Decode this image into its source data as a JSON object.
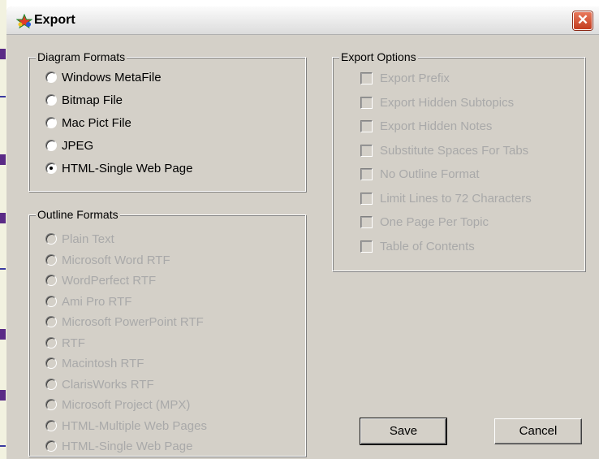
{
  "window": {
    "title": "Export",
    "close_label": "✕"
  },
  "diagram_formats": {
    "title": "Diagram Formats",
    "options": [
      {
        "label": "Windows MetaFile",
        "selected": false,
        "enabled": true
      },
      {
        "label": "Bitmap File",
        "selected": false,
        "enabled": true
      },
      {
        "label": "Mac Pict File",
        "selected": false,
        "enabled": true
      },
      {
        "label": "JPEG",
        "selected": false,
        "enabled": true
      },
      {
        "label": "HTML-Single Web Page",
        "selected": true,
        "enabled": true
      }
    ]
  },
  "outline_formats": {
    "title": "Outline Formats",
    "options": [
      {
        "label": "Plain Text",
        "enabled": false
      },
      {
        "label": "Microsoft Word RTF",
        "enabled": false
      },
      {
        "label": "WordPerfect RTF",
        "enabled": false
      },
      {
        "label": "Ami Pro RTF",
        "enabled": false
      },
      {
        "label": "Microsoft PowerPoint RTF",
        "enabled": false
      },
      {
        "label": "RTF",
        "enabled": false
      },
      {
        "label": "Macintosh RTF",
        "enabled": false
      },
      {
        "label": "ClarisWorks RTF",
        "enabled": false
      },
      {
        "label": "Microsoft Project (MPX)",
        "enabled": false
      },
      {
        "label": "HTML-Multiple Web Pages",
        "enabled": false
      },
      {
        "label": "HTML-Single Web Page",
        "enabled": false
      }
    ]
  },
  "export_options": {
    "title": "Export Options",
    "options": [
      {
        "label": "Export Prefix",
        "checked": false,
        "enabled": false
      },
      {
        "label": "Export Hidden Subtopics",
        "checked": false,
        "enabled": false
      },
      {
        "label": "Export Hidden Notes",
        "checked": false,
        "enabled": false
      },
      {
        "label": "Substitute Spaces For Tabs",
        "checked": false,
        "enabled": false
      },
      {
        "label": "No Outline Format",
        "checked": false,
        "enabled": false
      },
      {
        "label": "Limit Lines to 72 Characters",
        "checked": false,
        "enabled": false
      },
      {
        "label": "One Page Per Topic",
        "checked": false,
        "enabled": false
      },
      {
        "label": "Table of Contents",
        "checked": false,
        "enabled": false
      }
    ]
  },
  "buttons": {
    "save": "Save",
    "cancel": "Cancel"
  },
  "icons": {
    "app": "export-app-icon",
    "close": "close-icon"
  },
  "colors": {
    "dialog_bg": "#d4d0c8",
    "disabled_text": "#a9a9a9",
    "close_red": "#d24a2c"
  }
}
